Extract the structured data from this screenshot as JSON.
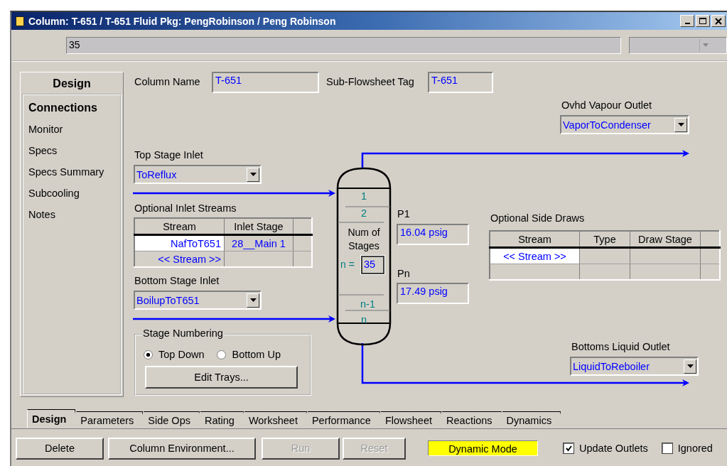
{
  "window": {
    "title": "Column: T-651 / T-651  Fluid Pkg: PengRobinson / Peng Robinson"
  },
  "toolbar": {
    "value": "35"
  },
  "sidebar": {
    "header": "Design",
    "items": [
      {
        "label": "Connections",
        "selected": true
      },
      {
        "label": "Monitor",
        "selected": false
      },
      {
        "label": "Specs",
        "selected": false
      },
      {
        "label": "Specs Summary",
        "selected": false
      },
      {
        "label": "Subcooling",
        "selected": false
      },
      {
        "label": "Notes",
        "selected": false
      }
    ]
  },
  "column_name": {
    "label": "Column Name",
    "value": "T-651"
  },
  "subflowsheet_tag": {
    "label": "Sub-Flowsheet Tag",
    "value": "T-651"
  },
  "ovhd_vapour_outlet": {
    "label": "Ovhd Vapour Outlet",
    "value": "VaporToCondenser"
  },
  "top_stage_inlet": {
    "label": "Top Stage Inlet",
    "value": "ToReflux"
  },
  "inlet_streams": {
    "label": "Optional Inlet Streams",
    "columns": [
      "Stream",
      "Inlet Stage"
    ],
    "rows": [
      {
        "stream": "NafToT651",
        "inlet_stage": "28__Main 1",
        "selected": true
      },
      {
        "stream": "<< Stream >>",
        "selected": false
      }
    ]
  },
  "bottom_stage_inlet": {
    "label": "Bottom Stage Inlet",
    "value": "BoilupToT651"
  },
  "stage_numbering": {
    "label": "Stage Numbering",
    "options": [
      {
        "label": "Top Down",
        "selected": true
      },
      {
        "label": "Bottom Up",
        "selected": false
      }
    ],
    "button": "Edit Trays..."
  },
  "column_diagram": {
    "top_stages": [
      "1",
      "2"
    ],
    "num_stages_label": "Num of Stages",
    "n_label": "n =",
    "n_value": "35",
    "bottom_stages": [
      "n-1",
      "n"
    ]
  },
  "p1": {
    "label": "P1",
    "value": "16.04 psig"
  },
  "pn": {
    "label": "Pn",
    "value": "17.49 psig"
  },
  "side_draws": {
    "label": "Optional Side Draws",
    "columns": [
      "Stream",
      "Type",
      "Draw Stage"
    ],
    "rows": [
      {
        "stream": "<< Stream >>",
        "selected": true
      }
    ]
  },
  "bottoms_liquid_outlet": {
    "label": "Bottoms Liquid Outlet",
    "value": "LiquidToReboiler"
  },
  "tabs": [
    {
      "label": "Design",
      "selected": true
    },
    {
      "label": "Parameters",
      "selected": false
    },
    {
      "label": "Side Ops",
      "selected": false
    },
    {
      "label": "Rating",
      "selected": false
    },
    {
      "label": "Worksheet",
      "selected": false
    },
    {
      "label": "Performance",
      "selected": false
    },
    {
      "label": "Flowsheet",
      "selected": false
    },
    {
      "label": "Reactions",
      "selected": false
    },
    {
      "label": "Dynamics",
      "selected": false
    }
  ],
  "buttons": [
    {
      "label": "Delete",
      "disabled": false
    },
    {
      "label": "Column Environment...",
      "disabled": false
    },
    {
      "label": "Run",
      "disabled": true
    },
    {
      "label": "Reset",
      "disabled": true
    }
  ],
  "mode_indicator": {
    "label": "Dynamic Mode"
  },
  "checkboxes": [
    {
      "label": "Update Outlets",
      "checked": true
    },
    {
      "label": "Ignored",
      "checked": false
    }
  ]
}
